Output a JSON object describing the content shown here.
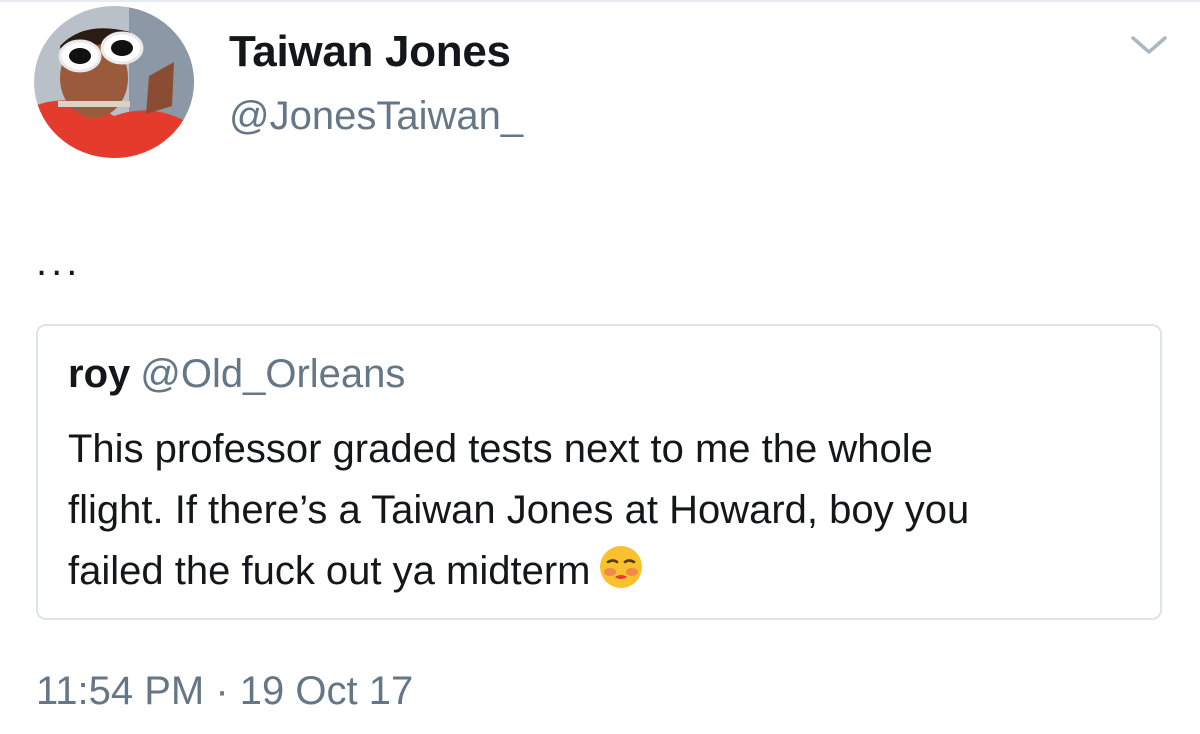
{
  "tweet": {
    "author": {
      "display_name": "Taiwan Jones",
      "handle": "@JonesTaiwan_"
    },
    "text": "...",
    "timestamp": "11:54 PM · 19 Oct 17"
  },
  "quoted_tweet": {
    "author_name": "roy",
    "author_handle": "@Old_Orleans",
    "lines": [
      "This professor graded tests next to me the whole",
      "flight. If there’s a Taiwan Jones at Howard, boy you",
      "failed the fuck out ya midterm"
    ],
    "emoji": "flushed-face-icon"
  },
  "colors": {
    "text_primary": "#14171a",
    "text_secondary": "#657786",
    "border": "#dde3e8",
    "caret": "#aab8c2",
    "emoji_yellow": "#f9c12e"
  }
}
